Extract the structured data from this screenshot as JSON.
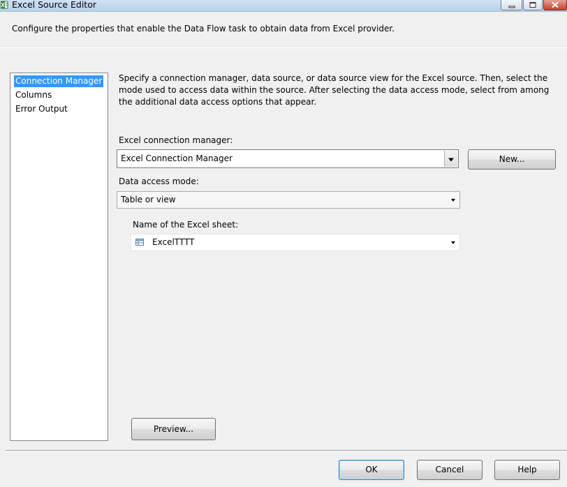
{
  "window": {
    "title": "Excel Source Editor",
    "app_icon": "excel-icon"
  },
  "header": {
    "description": "Configure the properties that enable the Data Flow task to obtain data from Excel provider."
  },
  "nav": {
    "items": [
      {
        "label": "Connection Manager",
        "selected": true
      },
      {
        "label": "Columns",
        "selected": false
      },
      {
        "label": "Error Output",
        "selected": false
      }
    ]
  },
  "main": {
    "description": "Specify a connection manager, data source, or data source view for the Excel source. Then, select the mode used to access data within the source. After selecting the data access mode, select from among the additional data access options that appear.",
    "connection_manager": {
      "label": "Excel connection manager:",
      "value": "Excel Connection Manager",
      "new_button": "New..."
    },
    "access_mode": {
      "label": "Data access mode:",
      "value": "Table or view"
    },
    "sheet": {
      "label": "Name of the Excel sheet:",
      "value": "ExcelTTTT",
      "icon": "table-icon"
    },
    "preview_button": "Preview..."
  },
  "footer": {
    "ok": "OK",
    "cancel": "Cancel",
    "help": "Help"
  },
  "colors": {
    "selection": "#3399ff",
    "window_bg": "#f0f0f0",
    "default_button_border": "#3c7fb1"
  }
}
